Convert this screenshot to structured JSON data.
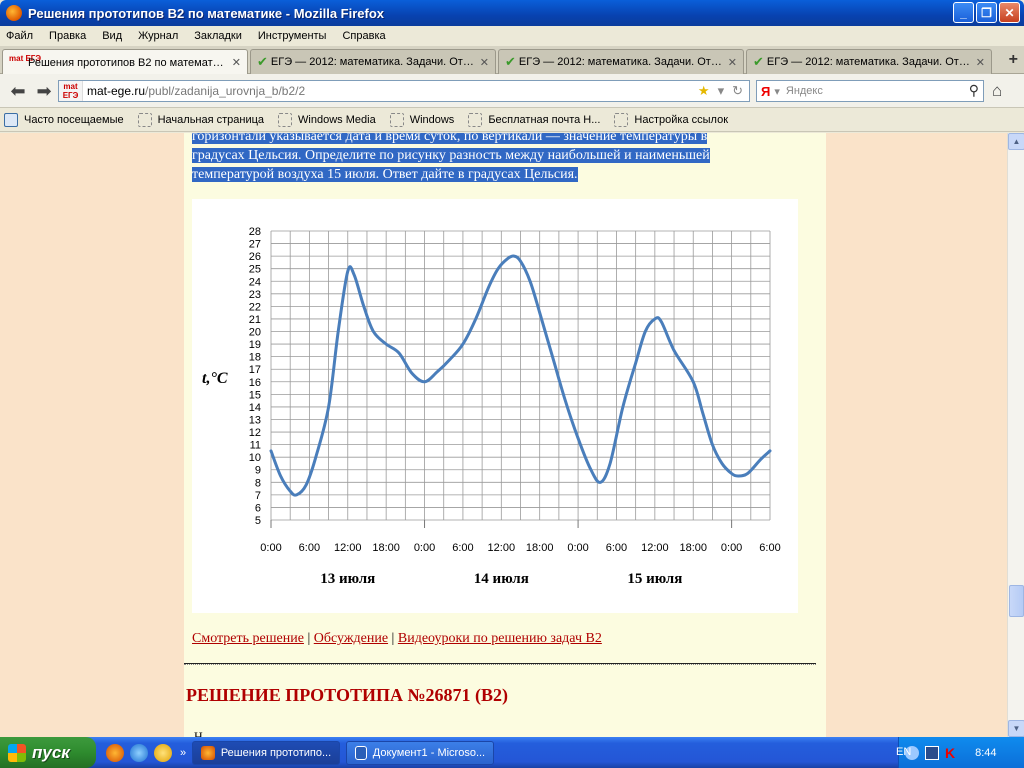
{
  "window": {
    "title": "Решения прототипов B2 по математике - Mozilla Firefox"
  },
  "menu": [
    "Файл",
    "Правка",
    "Вид",
    "Журнал",
    "Закладки",
    "Инструменты",
    "Справка"
  ],
  "tabs": [
    {
      "label": "Решения прототипов B2 по математике",
      "active": true
    },
    {
      "label": "ЕГЭ — 2012: математика. Задачи. Отв...",
      "active": false
    },
    {
      "label": "ЕГЭ — 2012: математика. Задачи. Отв...",
      "active": false
    },
    {
      "label": "ЕГЭ — 2012: математика. Задачи. Отв...",
      "active": false
    }
  ],
  "nav": {
    "site_icon_text": "mat ЕГЭ",
    "url_host": "mat-ege.ru",
    "url_path": "/publ/zadanija_urovnja_b/b2/2",
    "search_engine": "Я",
    "search_placeholder": "Яндекс"
  },
  "bookmarks": [
    "Часто посещаемые",
    "Начальная страница",
    "Windows Media",
    "Windows",
    "Бесплатная почта Н...",
    "Настройка ссылок"
  ],
  "content": {
    "selected_lines": [
      "горизонтали указывается дата и время суток, по вертикали — значение температуры в",
      "градусах Цельсия. Определите по рисунку разность между наибольшей и наименьшей",
      "температурой воздуха 15 июля. Ответ дайте в градусах Цельсия."
    ],
    "links": [
      "Смотреть решение",
      "Обсуждение",
      "Видеоуроки по решению задач B2"
    ],
    "heading": "РЕШЕНИЕ ПРОТОТИПА №26871 (B2)",
    "tail": "Н"
  },
  "chart_data": {
    "type": "line",
    "ylabel": "t,°C",
    "ylim": [
      5,
      28
    ],
    "yticks": [
      5,
      6,
      7,
      8,
      9,
      10,
      11,
      12,
      13,
      14,
      15,
      16,
      17,
      18,
      19,
      20,
      21,
      22,
      23,
      24,
      25,
      26,
      27,
      28
    ],
    "xticks": [
      "0:00",
      "6:00",
      "12:00",
      "18:00",
      "0:00",
      "6:00",
      "12:00",
      "18:00",
      "0:00",
      "6:00",
      "12:00",
      "18:00",
      "0:00",
      "6:00"
    ],
    "xlim_hours": [
      0,
      78
    ],
    "day_labels": [
      "13 июля",
      "14 июля",
      "15 июля"
    ],
    "grid": true,
    "color": "#4A7EBB",
    "series": [
      {
        "x_hours": [
          0,
          1.5,
          3,
          4,
          5.5,
          7,
          9,
          10.5,
          12,
          13,
          14.5,
          16,
          18,
          20,
          22,
          24,
          26,
          28,
          30,
          32,
          34,
          35.5,
          37,
          38,
          39,
          40.5,
          42,
          44,
          46,
          48,
          50,
          51.5,
          53,
          55,
          57,
          58.5,
          60,
          61,
          63,
          66,
          67.5,
          69,
          70.5,
          72,
          73,
          74.5,
          76.5,
          78
        ],
        "y": [
          10.5,
          8.5,
          7.3,
          7.0,
          7.8,
          10.0,
          14.0,
          20.0,
          24.8,
          24.5,
          22.0,
          20.0,
          19.0,
          18.3,
          16.7,
          16.0,
          16.8,
          17.8,
          19.0,
          21.0,
          23.5,
          25.0,
          25.8,
          26.0,
          25.6,
          24.0,
          21.5,
          18.0,
          14.5,
          11.5,
          9.0,
          8.0,
          9.5,
          14.0,
          17.5,
          20.0,
          21.0,
          20.8,
          18.5,
          16.0,
          13.5,
          11.0,
          9.5,
          8.7,
          8.5,
          8.7,
          9.8,
          10.5
        ]
      }
    ]
  },
  "taskbar": {
    "start_label": "пуск",
    "items": [
      {
        "label": "Решения прототипо...",
        "active": true
      },
      {
        "label": "Документ1 - Microso...",
        "active": false
      }
    ],
    "lang": "EN",
    "time": "8:44"
  }
}
